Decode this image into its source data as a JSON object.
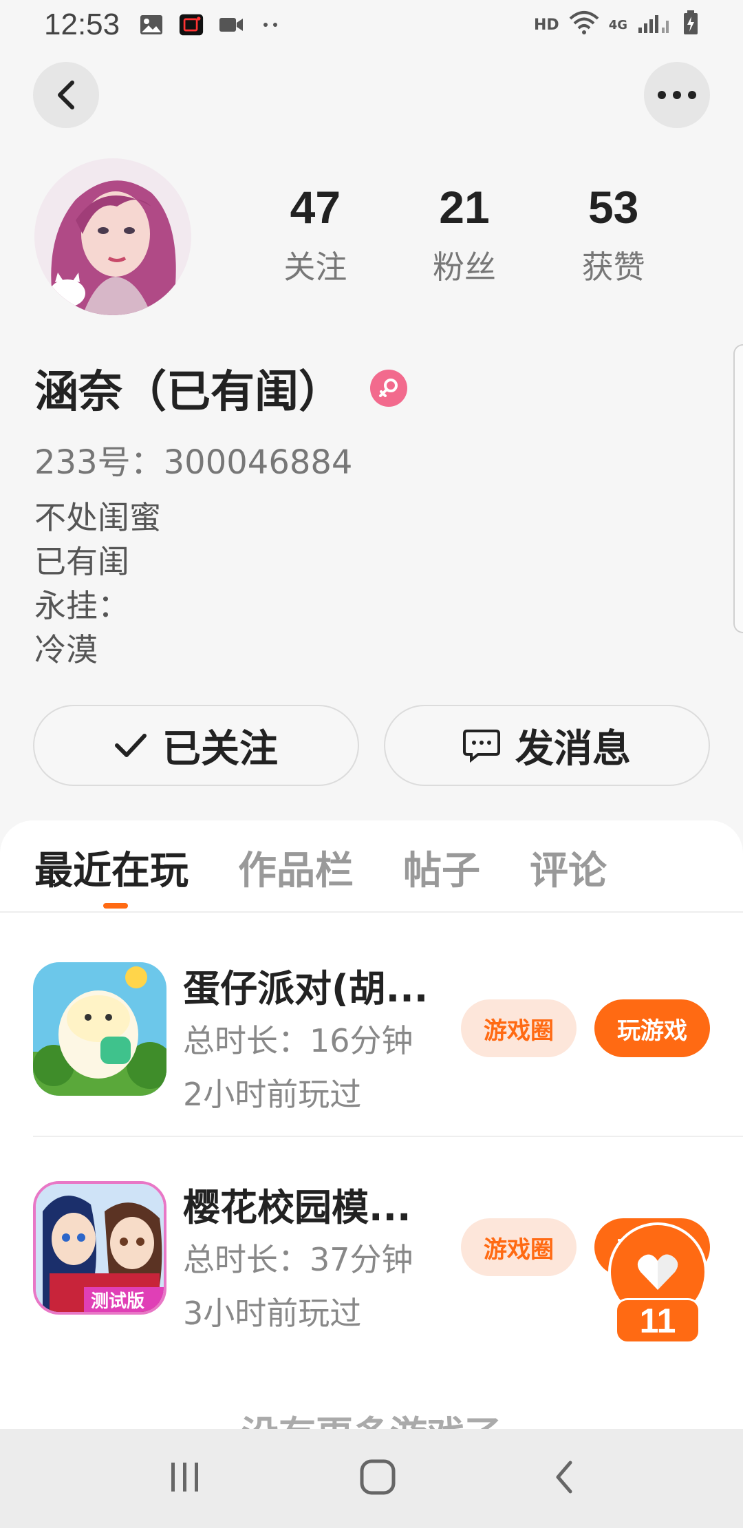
{
  "status_bar": {
    "time": "12:53",
    "network_label": "HD",
    "signal_label": "4G",
    "icons": [
      "gallery-icon",
      "screen-record-icon",
      "video-icon",
      "more-dots-icon",
      "wifi-icon",
      "signal-icon",
      "battery-charging-icon"
    ]
  },
  "header": {
    "back_icon": "back-arrow-icon",
    "more_icon": "more-horizontal-icon"
  },
  "profile": {
    "stats": [
      {
        "value": "47",
        "label": "关注"
      },
      {
        "value": "21",
        "label": "粉丝"
      },
      {
        "value": "53",
        "label": "获赞"
      }
    ],
    "nickname": "涵奈（已有闺）",
    "gender_icon": "female-icon",
    "account_id": "233号：300046884",
    "bio": [
      "不处闺蜜",
      "已有闺",
      "永挂：",
      "冷漠"
    ]
  },
  "actions": {
    "follow_label": "已关注",
    "message_label": "发消息"
  },
  "tabs": [
    {
      "label": "最近在玩",
      "active": true
    },
    {
      "label": "作品栏",
      "active": false
    },
    {
      "label": "帖子",
      "active": false
    },
    {
      "label": "评论",
      "active": false
    }
  ],
  "games": [
    {
      "title": "蛋仔派对(胡...",
      "duration": "总时长：16分钟",
      "last_played": "2小时前玩过",
      "circle_label": "游戏圈",
      "play_label": "玩游戏"
    },
    {
      "title": "樱花校园模...",
      "duration": "总时长：37分钟",
      "last_played": "3小时前玩过",
      "circle_label": "游戏圈",
      "play_label": "玩游戏",
      "icon_badge": "测试版"
    }
  ],
  "footer_text": "没有更多游戏了",
  "float_like": {
    "count": "11"
  },
  "colors": {
    "accent": "#ff6a13",
    "accent_light": "#fde6da",
    "gender": "#f26a8d"
  }
}
